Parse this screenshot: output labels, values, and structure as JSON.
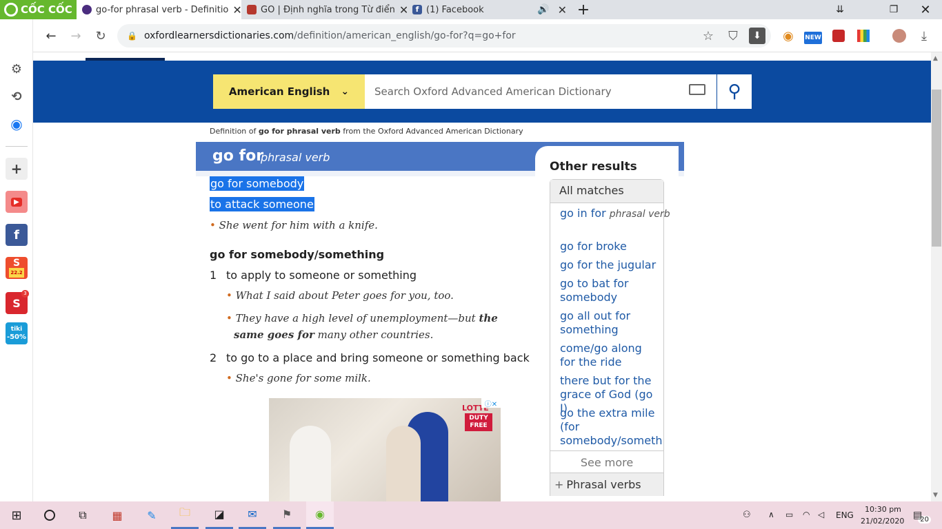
{
  "browser": {
    "brand": "CỐC CỐC",
    "tabs": [
      {
        "title": "go-for phrasal verb - Definitio",
        "active": true
      },
      {
        "title": "GO | Định nghĩa trong Từ điển",
        "active": false
      },
      {
        "title": "(1) Facebook",
        "active": false
      }
    ],
    "url_host": "oxfordlearnersdictionaries.com",
    "url_path": "/definition/american_english/go-for?q=go+for",
    "extension_badge": "NEW"
  },
  "sidebar": {
    "tiki_label": "tiki",
    "tiki_badge": "-50%",
    "shopee_badge": "22.2",
    "sendo_badge": "3"
  },
  "header": {
    "dictionary_select": "American English",
    "search_placeholder": "Search Oxford Advanced American Dictionary"
  },
  "entry": {
    "source_prefix": "Definition of",
    "source_term": "go for phrasal verb",
    "source_suffix": "from the Oxford Advanced American Dictionary",
    "headword": "go for",
    "pos": "phrasal verb",
    "sense1_phrase": "go for somebody",
    "sense1_def": "to attack someone",
    "sense1_example": "She went for him with a knife.",
    "pv2": "go for somebody/something",
    "def1_num": "1",
    "def1_text": "to apply to someone or something",
    "def1_ex1": "What I said about Peter goes for you, too.",
    "def1_ex2_a": "They have a high level of unemployment—but ",
    "def1_ex2_b": "the same goes for",
    "def1_ex2_c": " many other countries.",
    "def2_num": "2",
    "def2_text": "to go to a place and bring someone or something back",
    "def2_ex1": "She's gone for some milk."
  },
  "other_results": {
    "heading": "Other results",
    "tab": "All matches",
    "items": [
      {
        "text": "go in for",
        "pos": "phrasal verb"
      },
      {
        "text": "go for broke"
      },
      {
        "text": "go for the jugular"
      },
      {
        "text": "go to bat for somebody"
      },
      {
        "text": "go all out for something"
      },
      {
        "text": "come/go along for the ride"
      },
      {
        "text": "there but for the grace of God (go I)"
      },
      {
        "text": "go the extra mile (for somebody/something)"
      }
    ],
    "see_more": "See more",
    "phrasal": "Phrasal verbs"
  },
  "ad": {
    "brand": "LOTTE",
    "tag": "DUTY FREE"
  },
  "taskbar": {
    "lang": "ENG",
    "time": "10:30 pm",
    "date": "21/02/2020",
    "notif": "20"
  },
  "colors": {
    "header_blue": "#0b4aa0",
    "title_blue": "#4a76c4",
    "select_yellow": "#f6e572",
    "link_blue": "#1f5aa6",
    "selection": "#1a73e8"
  }
}
